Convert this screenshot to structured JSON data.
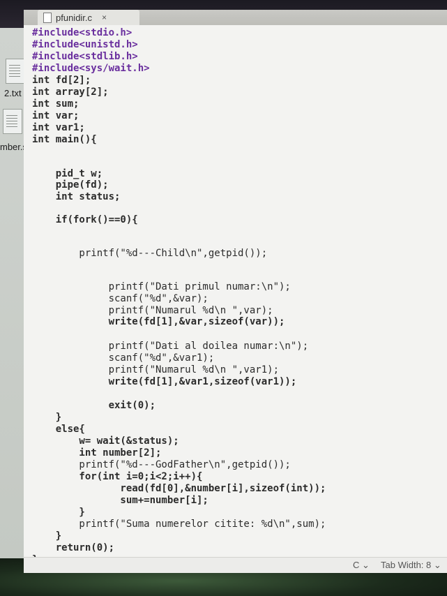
{
  "window": {
    "tab_title": "pfunidir.c",
    "tab_close": "×"
  },
  "desktop": {
    "labels": [
      "2.txt",
      "mber.s"
    ]
  },
  "code": {
    "lines": [
      "#include<stdio.h>",
      "#include<unistd.h>",
      "#include<stdlib.h>",
      "#include<sys/wait.h>",
      "int fd[2];",
      "int array[2];",
      "int sum;",
      "int var;",
      "int var1;",
      "int main(){",
      "",
      "    pid_t w;",
      "    pipe(fd);",
      "    int status;",
      "",
      "    if(fork()==0){",
      "",
      "        printf(\"%d---Child\\n\",getpid());",
      "",
      "             printf(\"Dati primul numar:\\n\");",
      "             scanf(\"%d\",&var);",
      "             printf(\"Numarul %d\\n \",var);",
      "             write(fd[1],&var,sizeof(var));",
      "",
      "             printf(\"Dati al doilea numar:\\n\");",
      "             scanf(\"%d\",&var1);",
      "             printf(\"Numarul %d\\n \",var1);",
      "             write(fd[1],&var1,sizeof(var1));",
      "",
      "             exit(0);",
      "    }",
      "    else{",
      "        w= wait(&status);",
      "        int number[2];",
      "        printf(\"%d---GodFather\\n\",getpid());",
      "        for(int i=0;i<2;i++){",
      "               read(fd[0],&number[i],sizeof(int));",
      "               sum+=number[i];",
      "        }",
      "        printf(\"Suma numerelor citite: %d\\n\",sum);",
      "    }",
      "    return(0);",
      "}"
    ]
  },
  "statusbar": {
    "language": "C ⌄",
    "tab_width": "Tab Width: 8 ⌄"
  }
}
